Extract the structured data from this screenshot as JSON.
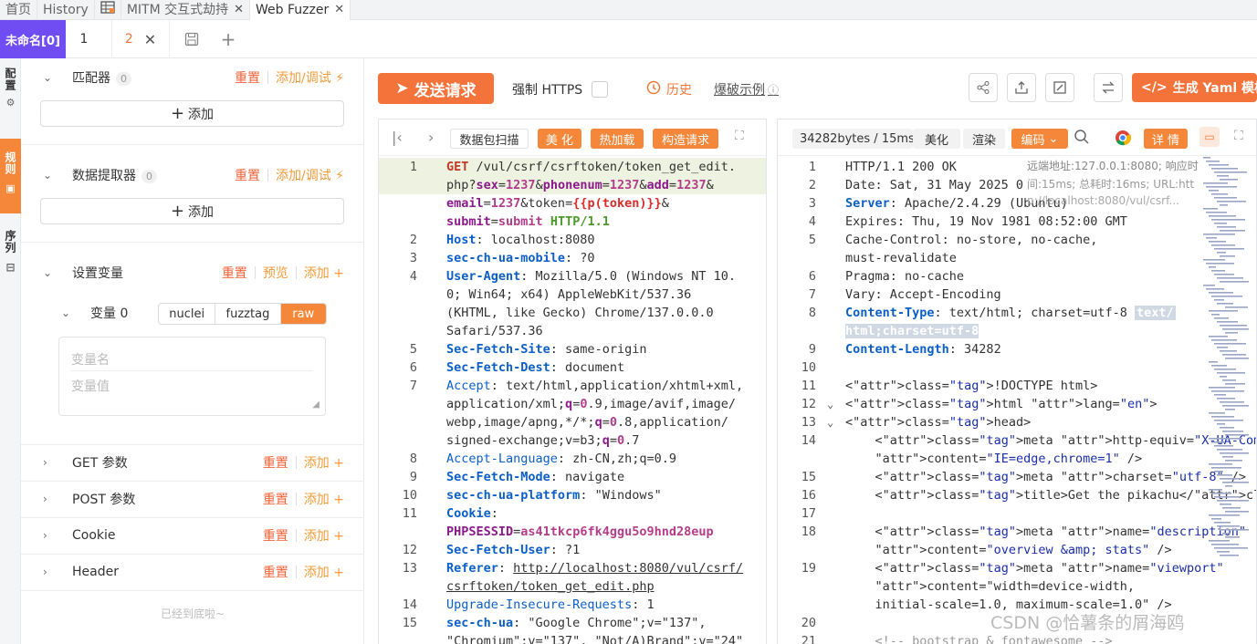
{
  "top_tabs": {
    "home": "首页",
    "history": "History",
    "mitm": "MITM 交互式劫持",
    "fuzzer": "Web Fuzzer"
  },
  "sub_tabs": {
    "unnamed": "未命名[0]",
    "tab1": "1",
    "tab2": "2"
  },
  "side_tabs": {
    "config": "配置",
    "rules": "规则",
    "sequence": "序列"
  },
  "left": {
    "matcher_title": "匹配器",
    "matcher_count": "0",
    "extractor_title": "数据提取器",
    "extractor_count": "0",
    "reset": "重置",
    "add_debug": "添加/调试",
    "add_plus": "添加",
    "vars_title": "设置变量",
    "preview": "预览",
    "add": "添加",
    "var0": "变量 0",
    "var_modes": [
      "nuclei",
      "fuzztag",
      "raw"
    ],
    "var_name_ph": "变量名",
    "var_value_ph": "变量值",
    "get_params": "GET 参数",
    "post_params": "POST 参数",
    "cookie": "Cookie",
    "header": "Header",
    "bottom_note": "已经到底啦~"
  },
  "toolbar": {
    "send": "发送请求",
    "force_https": "强制 HTTPS",
    "history": "历史",
    "brute_example": "爆破示例",
    "gen_yaml": "生成 Yaml 模板"
  },
  "req_toolbar": {
    "scan": "数据包扫描",
    "beautify": "美 化",
    "hot_load": "热加载",
    "construct": "构造请求"
  },
  "resp_toolbar": {
    "size": "34282bytes / 15ms",
    "beautify": "美化",
    "render": "渲染",
    "encoding": "编码",
    "detail": "详 情"
  },
  "resp_overlay": {
    "remote": "远端地址:127.0.0.1:8080; 响应时",
    "time": "间:15ms; 总耗时:16ms; URL:htt",
    "url": "p://localhost:8080/vul/csrf..."
  },
  "request_lines": [
    {
      "n": "1",
      "t": "GET /vul/csrf/csrftoken/token_get_edit."
    },
    {
      "n": "",
      "t": "php?sex=1237&phonenum=1237&add=1237&"
    },
    {
      "n": "",
      "t": "email=1237&token={{p(token)}}&"
    },
    {
      "n": "",
      "t": "submit=submit HTTP/1.1"
    },
    {
      "n": "2",
      "t": "Host: localhost:8080"
    },
    {
      "n": "3",
      "t": "sec-ch-ua-mobile: ?0"
    },
    {
      "n": "4",
      "t": "User-Agent: Mozilla/5.0 (Windows NT 10."
    },
    {
      "n": "",
      "t": "0; Win64; x64) AppleWebKit/537.36"
    },
    {
      "n": "",
      "t": "(KHTML, like Gecko) Chrome/137.0.0.0"
    },
    {
      "n": "",
      "t": "Safari/537.36"
    },
    {
      "n": "5",
      "t": "Sec-Fetch-Site: same-origin"
    },
    {
      "n": "6",
      "t": "Sec-Fetch-Dest: document"
    },
    {
      "n": "7",
      "t": "Accept: text/html,application/xhtml+xml,"
    },
    {
      "n": "",
      "t": "application/xml;q=0.9,image/avif,image/"
    },
    {
      "n": "",
      "t": "webp,image/apng,*/*;q=0.8,application/"
    },
    {
      "n": "",
      "t": "signed-exchange;v=b3;q=0.7"
    },
    {
      "n": "8",
      "t": "Accept-Language: zh-CN,zh;q=0.9"
    },
    {
      "n": "9",
      "t": "Sec-Fetch-Mode: navigate"
    },
    {
      "n": "10",
      "t": "sec-ch-ua-platform: \"Windows\""
    },
    {
      "n": "11",
      "t": "Cookie:"
    },
    {
      "n": "",
      "t": "PHPSESSID=as41tkcp6fk4ggu5o9hnd28eup"
    },
    {
      "n": "12",
      "t": "Sec-Fetch-User: ?1"
    },
    {
      "n": "13",
      "t": "Referer: http://localhost:8080/vul/csrf/"
    },
    {
      "n": "",
      "t": "csrftoken/token_get_edit.php"
    },
    {
      "n": "14",
      "t": "Upgrade-Insecure-Requests: 1"
    },
    {
      "n": "15",
      "t": "sec-ch-ua: \"Google Chrome\";v=\"137\","
    },
    {
      "n": "",
      "t": "\"Chromium\";v=\"137\", \"Not/A)Brand\";v=\"24\""
    }
  ],
  "response_lines": [
    {
      "n": "1",
      "t": "HTTP/1.1 200 OK"
    },
    {
      "n": "2",
      "t": "Date: Sat, 31 May 2025 0"
    },
    {
      "n": "3",
      "t": "Server: Apache/2.4.29 (Ubuntu)"
    },
    {
      "n": "4",
      "t": "Expires: Thu, 19 Nov 1981 08:52:00 GMT"
    },
    {
      "n": "5",
      "t": "Cache-Control: no-store, no-cache,"
    },
    {
      "n": "",
      "t": "must-revalidate"
    },
    {
      "n": "6",
      "t": "Pragma: no-cache"
    },
    {
      "n": "7",
      "t": "Vary: Accept-Encoding"
    },
    {
      "n": "8",
      "t": "Content-Type: text/html; charset=utf-8"
    },
    {
      "n": "",
      "t": "html;charset=utf-8"
    },
    {
      "n": "9",
      "t": "Content-Length: 34282"
    },
    {
      "n": "10",
      "t": ""
    },
    {
      "n": "11",
      "t": "<!DOCTYPE html>"
    },
    {
      "n": "12",
      "t": "<html lang=\"en\">"
    },
    {
      "n": "13",
      "t": "<head>"
    },
    {
      "n": "14",
      "t": "    <meta http-equiv=\"X-UA-Compatible\""
    },
    {
      "n": "",
      "t": "    content=\"IE=edge,chrome=1\" />"
    },
    {
      "n": "15",
      "t": "    <meta charset=\"utf-8\" />"
    },
    {
      "n": "16",
      "t": "    <title>Get the pikachu</title>"
    },
    {
      "n": "17",
      "t": ""
    },
    {
      "n": "18",
      "t": "    <meta name=\"description\""
    },
    {
      "n": "",
      "t": "    content=\"overview &amp; stats\" />"
    },
    {
      "n": "19",
      "t": "    <meta name=\"viewport\""
    },
    {
      "n": "",
      "t": "    content=\"width=device-width,"
    },
    {
      "n": "",
      "t": "    initial-scale=1.0, maximum-scale=1.0\" />"
    },
    {
      "n": "20",
      "t": ""
    },
    {
      "n": "21",
      "t": "    <!-- bootstrap & fontawesome -->"
    }
  ],
  "ct_badge": "text/",
  "watermark": "CSDN @恰薯条的屑海鸥"
}
